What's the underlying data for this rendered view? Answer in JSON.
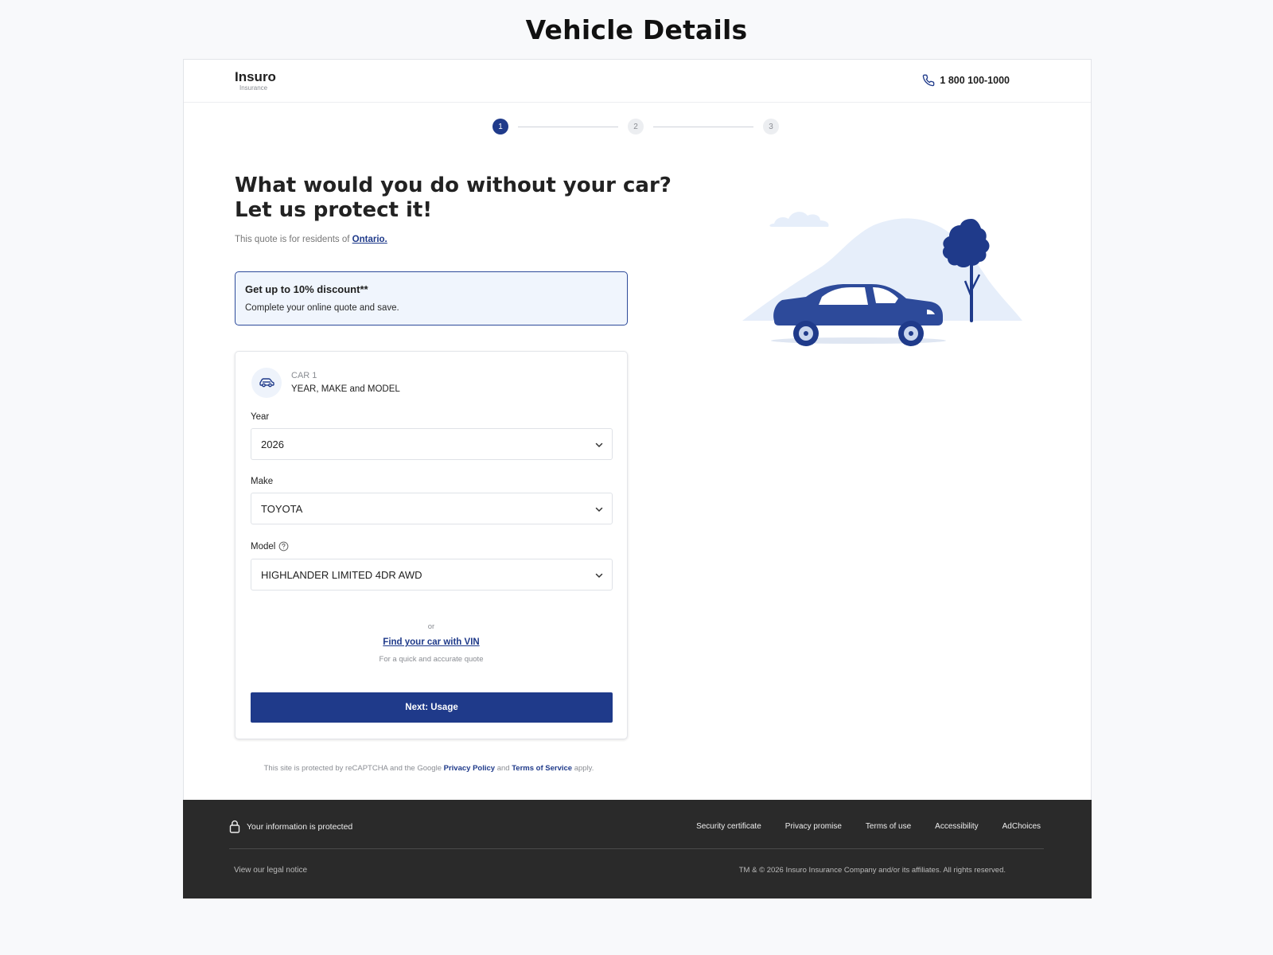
{
  "page_title": "Vehicle Details",
  "header": {
    "logo_name": "Insuro",
    "logo_sub": "Insurance",
    "phone": "1 800 100-1000"
  },
  "stepper": {
    "steps": [
      "1",
      "2",
      "3"
    ],
    "active_step": 1
  },
  "hero": {
    "title_line1": "What would you do without your car?",
    "title_line2": "Let us protect it!",
    "residents_prefix": "This quote is for residents of",
    "province": "Ontario."
  },
  "discount": {
    "title": "Get up to 10% discount**",
    "text": "Complete your online quote and save."
  },
  "vehicle_card": {
    "car_label": "CAR 1",
    "car_sub": "YEAR, MAKE and MODEL",
    "year_label": "Year",
    "year_value": "2026",
    "make_label": "Make",
    "make_value": "TOYOTA",
    "model_label": "Model",
    "model_value": "HIGHLANDER LIMITED 4DR AWD",
    "or_text": "or",
    "vin_link": "Find your car with VIN",
    "vin_sub": "For a quick and accurate quote",
    "next_button": "Next: Usage"
  },
  "recaptcha": {
    "prefix": "This site is protected by reCAPTCHA and the Google",
    "privacy": "Privacy Policy",
    "and": "and",
    "terms": "Terms of Service",
    "suffix": "apply."
  },
  "footer": {
    "protected": "Your information is protected",
    "links": [
      "Security certificate",
      "Privacy promise",
      "Terms of use",
      "Accessibility",
      "AdChoices"
    ],
    "legal": "View our legal notice",
    "copyright": "TM & © 2026 Insuro Insurance Company and/or its affiliates. All rights reserved."
  },
  "colors": {
    "primary": "#1f3a8a",
    "footer_bg": "#2a2a2a",
    "discount_bg": "#f0f5fd"
  }
}
